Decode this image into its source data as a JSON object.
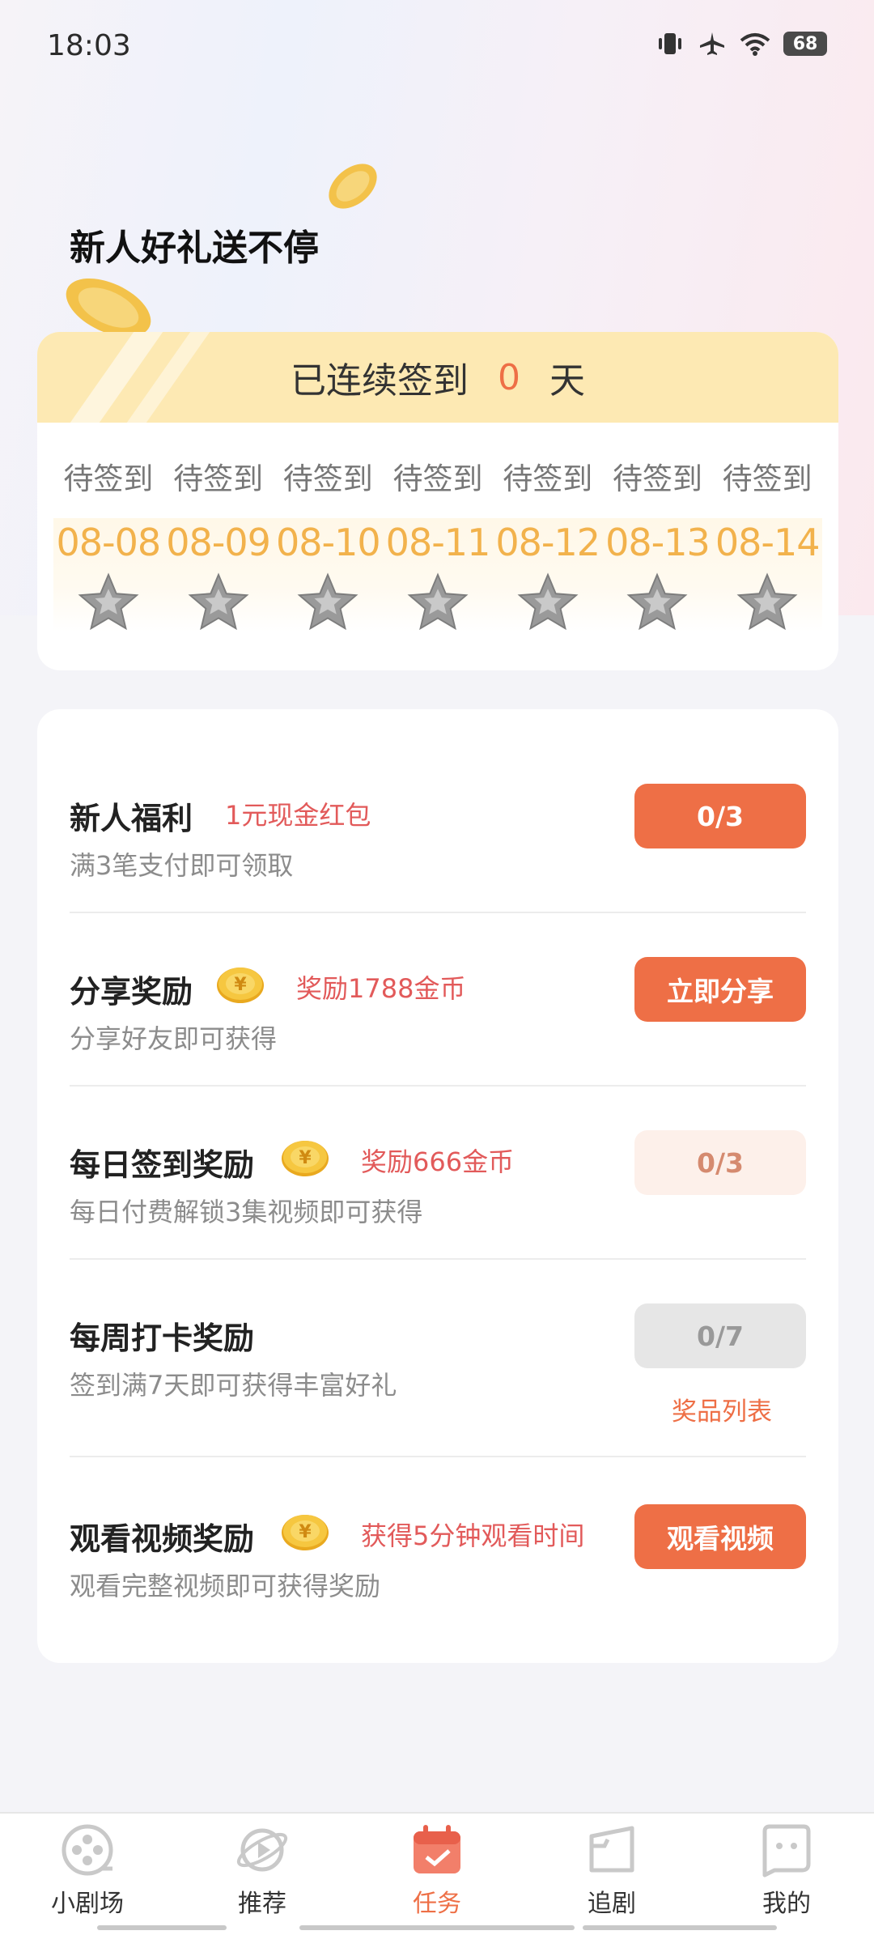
{
  "status": {
    "time": "18:03",
    "battery": "68"
  },
  "header": {
    "title": "新人好礼送不停"
  },
  "signin": {
    "prefix": "已连续签到",
    "days": "0",
    "suffix": "天",
    "items": [
      {
        "status": "待签到",
        "date": "08-08"
      },
      {
        "status": "待签到",
        "date": "08-09"
      },
      {
        "status": "待签到",
        "date": "08-10"
      },
      {
        "status": "待签到",
        "date": "08-11"
      },
      {
        "status": "待签到",
        "date": "08-12"
      },
      {
        "status": "待签到",
        "date": "08-13"
      },
      {
        "status": "待签到",
        "date": "08-14"
      }
    ]
  },
  "tasks": [
    {
      "name": "新人福利",
      "reward": "1元现金红包",
      "desc": "满3笔支付即可领取",
      "button": "0/3"
    },
    {
      "name": "分享奖励",
      "reward": "奖励1788金币",
      "desc": "分享好友即可获得",
      "button": "立即分享"
    },
    {
      "name": "每日签到奖励",
      "reward": "奖励666金币",
      "desc": "每日付费解锁3集视频即可获得",
      "button": "0/3"
    },
    {
      "name": "每周打卡奖励",
      "reward": "",
      "desc": "签到满7天即可获得丰富好礼",
      "button": "0/7",
      "link": "奖品列表"
    },
    {
      "name": "观看视频奖励",
      "reward": "获得5分钟观看时间",
      "desc": "观看完整视频即可获得奖励",
      "button": "观看视频"
    }
  ],
  "tabbar": {
    "items": [
      {
        "label": "小剧场",
        "icon": "film-reel-icon"
      },
      {
        "label": "推荐",
        "icon": "planet-play-icon"
      },
      {
        "label": "任务",
        "icon": "calendar-task-icon"
      },
      {
        "label": "追剧",
        "icon": "folder-icon"
      },
      {
        "label": "我的",
        "icon": "face-icon"
      }
    ],
    "active": "任务"
  },
  "colors": {
    "accent": "#ee6f46",
    "gold": "#f2b24c",
    "reward": "#e25a5a"
  }
}
